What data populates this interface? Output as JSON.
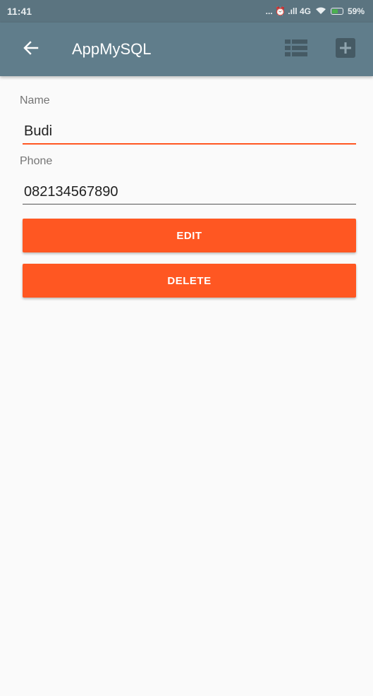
{
  "status_bar": {
    "time": "11:41",
    "indicators": "... ⏰ .ıll 4G",
    "battery_percent": "59%"
  },
  "app_bar": {
    "title": "AppMySQL",
    "icons": [
      "arrow-back-icon",
      "list-icon",
      "add-box-icon"
    ]
  },
  "form": {
    "name_label": "Name",
    "name_value": "Budi",
    "phone_label": "Phone",
    "phone_value": "082134567890"
  },
  "actions": {
    "edit_label": "EDIT",
    "delete_label": "DELETE"
  },
  "colors": {
    "toolbar": "#607d8b",
    "status_bar": "#5b7480",
    "accent": "#ff5722",
    "background": "#fafafa"
  }
}
